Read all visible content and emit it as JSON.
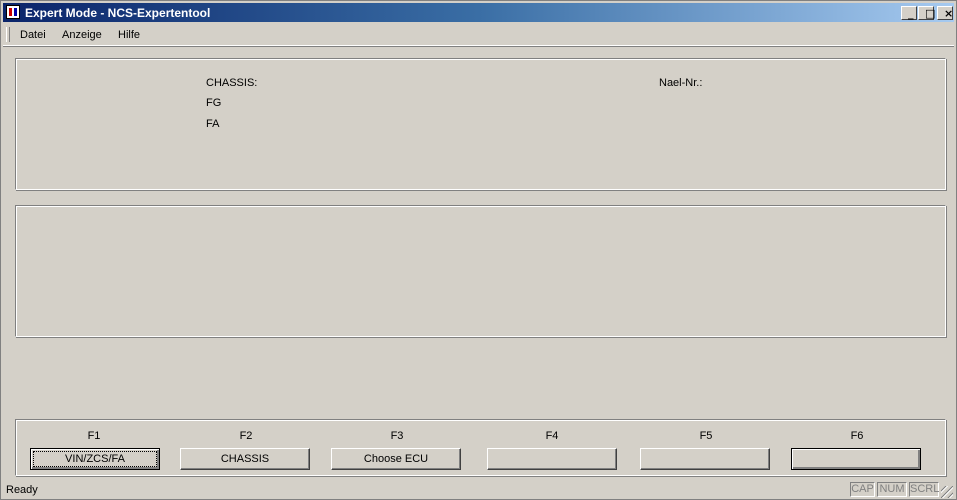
{
  "window": {
    "title": "Expert Mode - NCS-Expertentool",
    "controls": {
      "minimize": "_",
      "maximize": "□",
      "close": "×"
    }
  },
  "menu": {
    "items": [
      {
        "label": "Datei"
      },
      {
        "label": "Anzeige"
      },
      {
        "label": "Hilfe"
      }
    ]
  },
  "info": {
    "chassis_label": "CHASSIS:",
    "fg_label": "FG",
    "fa_label": "FA",
    "nael_label": "Nael-Nr.:"
  },
  "function_keys": [
    {
      "key": "F1",
      "label": "VIN/ZCS/FA"
    },
    {
      "key": "F2",
      "label": "CHASSIS"
    },
    {
      "key": "F3",
      "label": "Choose ECU"
    },
    {
      "key": "F4",
      "label": ""
    },
    {
      "key": "F5",
      "label": ""
    },
    {
      "key": "F6",
      "label": ""
    }
  ],
  "status": {
    "text": "Ready",
    "indicators": [
      "CAP",
      "NUM",
      "SCRL"
    ]
  }
}
